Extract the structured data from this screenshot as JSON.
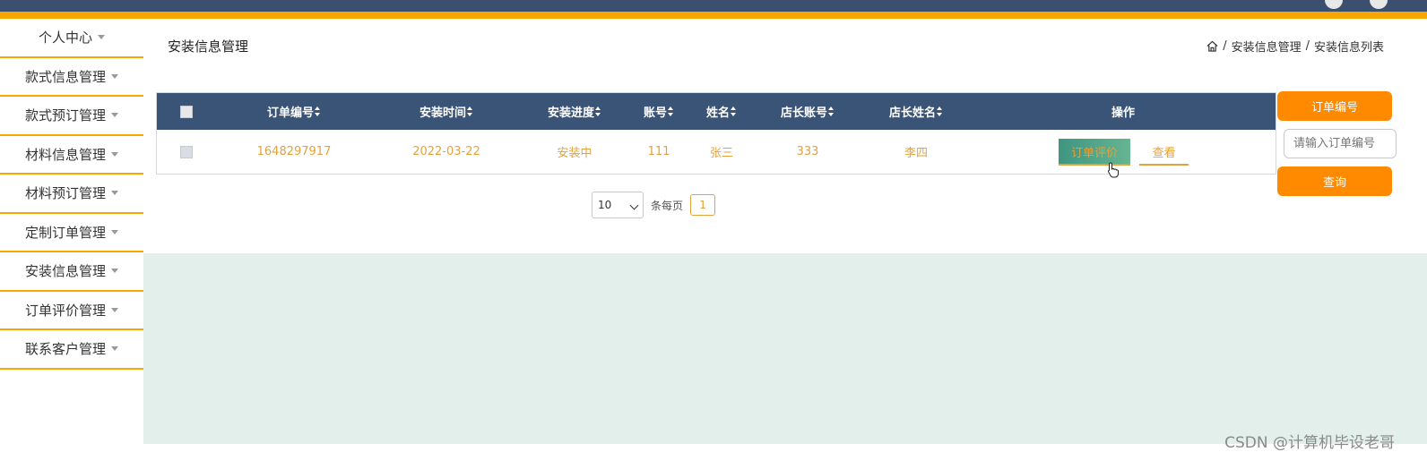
{
  "sidebar": {
    "items": [
      {
        "label": "个人中心"
      },
      {
        "label": "款式信息管理"
      },
      {
        "label": "款式预订管理"
      },
      {
        "label": "材料信息管理"
      },
      {
        "label": "材料预订管理"
      },
      {
        "label": "定制订单管理"
      },
      {
        "label": "安装信息管理"
      },
      {
        "label": "订单评价管理"
      },
      {
        "label": "联系客户管理"
      }
    ]
  },
  "header": {
    "title": "安装信息管理",
    "breadcrumb": [
      "安装信息管理",
      "安装信息列表"
    ],
    "separator": "/"
  },
  "table": {
    "columns": [
      "订单编号",
      "安装时间",
      "安装进度",
      "账号",
      "姓名",
      "店长账号",
      "店长姓名",
      "操作"
    ],
    "rows": [
      {
        "order_no": "1648297917",
        "install_time": "2022-03-22",
        "progress": "安装中",
        "account": "111",
        "name": "张三",
        "manager_account": "333",
        "manager_name": "李四",
        "actions": {
          "evaluate": "订单评价",
          "view": "查看"
        }
      }
    ]
  },
  "pagination": {
    "page_size": "10",
    "per_page_label": "条每页",
    "current_page": "1"
  },
  "search": {
    "label": "订单编号",
    "placeholder": "请输入订单编号",
    "button": "查询"
  },
  "watermark": "CSDN @计算机毕设老哥",
  "colors": {
    "topbar": "#3a506e",
    "accent": "#f7a700",
    "table_header": "#3a5478",
    "cell_text": "#e3a23c",
    "search_button": "#ff8a00",
    "content_bg": "#e3efeb"
  }
}
